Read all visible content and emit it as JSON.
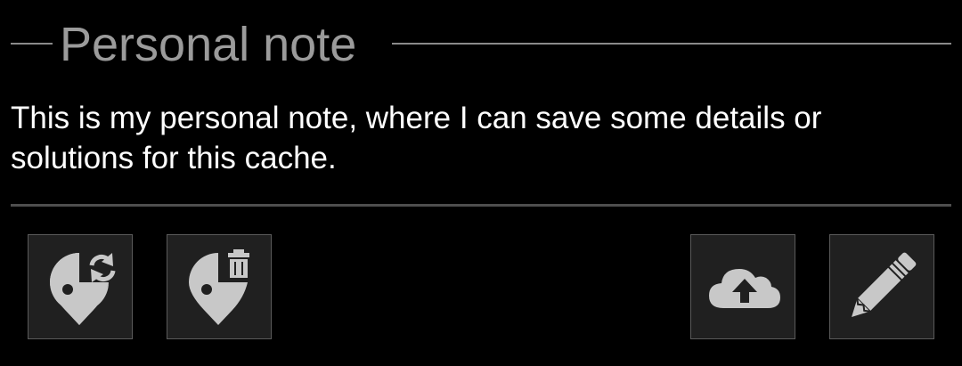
{
  "header": {
    "title": "Personal note"
  },
  "note": {
    "text": "This is my personal note, where I can save some details or solutions for this cache."
  },
  "actions": [
    {
      "name": "refresh-waypoint-button",
      "icon": "map-marker-refresh-icon"
    },
    {
      "name": "delete-waypoint-button",
      "icon": "map-marker-delete-icon"
    },
    {
      "name": "upload-note-button",
      "icon": "cloud-upload-icon"
    },
    {
      "name": "edit-note-button",
      "icon": "pencil-icon"
    }
  ],
  "colors": {
    "background": "#000000",
    "title": "#9b9b9b",
    "text": "#ffffff",
    "icon": "#c8c8c8",
    "button_bg": "#202020",
    "button_border": "#5a5a5a"
  }
}
